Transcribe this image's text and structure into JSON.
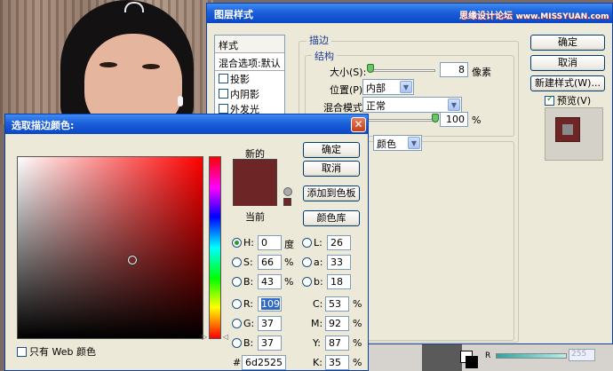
{
  "layer_style": {
    "title": "图层样式",
    "watermark_brand": "思缘设计论坛",
    "watermark_url": "www.MISSYUAN.com",
    "list_header": "样式",
    "list_blending": "混合选项:默认",
    "list_items": [
      "投影",
      "内阴影",
      "外发光"
    ],
    "stroke_title": "描边",
    "structure_title": "结构",
    "size_label": "大小(S):",
    "size_value": "8",
    "size_unit": "像素",
    "position_label": "位置(P):",
    "position_value": "内部",
    "blend_label": "混合模式:",
    "blend_value": "正常",
    "opacity_value": "100",
    "opacity_unit": "%",
    "fill_type_value": "颜色",
    "buttons": {
      "ok": "确定",
      "cancel": "取消",
      "new_style": "新建样式(W)...",
      "preview": "预览(V)"
    },
    "preview_checked": true
  },
  "color_picker": {
    "title": "选取描边颜色:",
    "new_label": "新的",
    "current_label": "当前",
    "buttons": {
      "ok": "确定",
      "cancel": "取消",
      "add_swatch": "添加到色板",
      "libraries": "颜色库"
    },
    "web_only_label": "只有 Web 颜色",
    "current_color": "#6d2525",
    "fields": {
      "H": {
        "label": "H:",
        "value": "0",
        "unit": "度"
      },
      "S": {
        "label": "S:",
        "value": "66",
        "unit": "%"
      },
      "B": {
        "label": "B:",
        "value": "43",
        "unit": "%"
      },
      "R": {
        "label": "R:",
        "value": "109"
      },
      "G": {
        "label": "G:",
        "value": "37"
      },
      "Bb": {
        "label": "B:",
        "value": "37"
      },
      "L": {
        "label": "L:",
        "value": "26"
      },
      "a": {
        "label": "a:",
        "value": "33"
      },
      "b": {
        "label": "b:",
        "value": "18"
      },
      "C": {
        "label": "C:",
        "value": "53",
        "unit": "%"
      },
      "M": {
        "label": "M:",
        "value": "92",
        "unit": "%"
      },
      "Y": {
        "label": "Y:",
        "value": "87",
        "unit": "%"
      },
      "K": {
        "label": "K:",
        "value": "35",
        "unit": "%"
      }
    },
    "hex_label": "#",
    "hex_value": "6d2525"
  },
  "background_panel": {
    "slider_label": "R",
    "slider_value": "255"
  }
}
